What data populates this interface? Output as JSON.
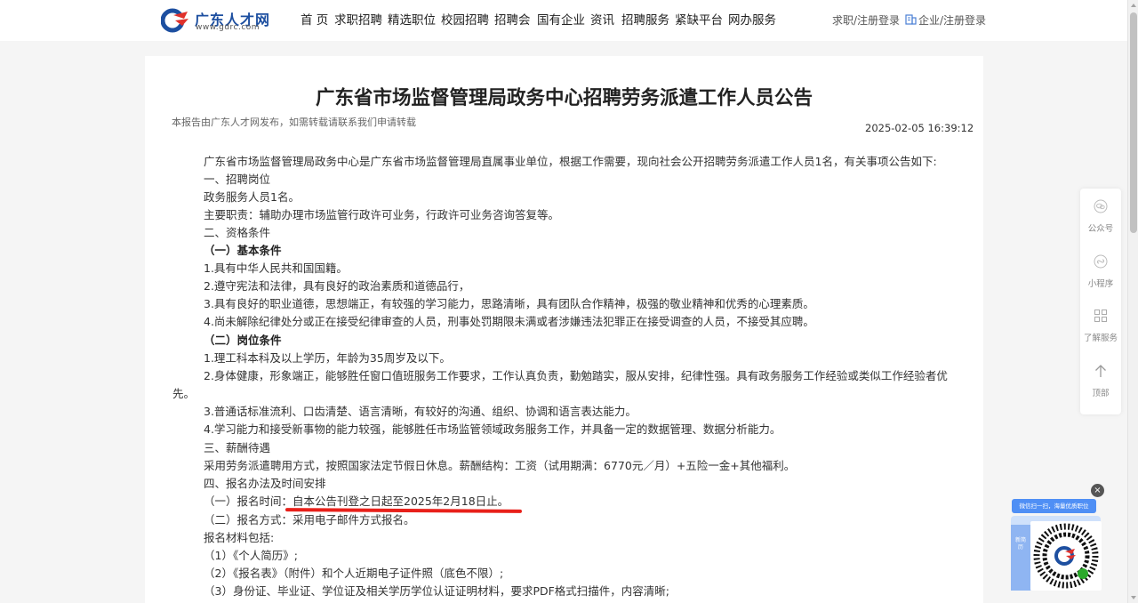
{
  "header": {
    "logo_title": "广东人才网",
    "logo_url": "www.gdrc.com",
    "nav": [
      "首 页",
      "求职招聘",
      "精选职位",
      "校园招聘",
      "招聘会",
      "国有企业",
      "资讯",
      "招聘服务",
      "紧缺平台",
      "网办服务"
    ],
    "login_personal": "求职/注册登录",
    "login_company": "企业/注册登录"
  },
  "article": {
    "title": "广东省市场监督管理局政务中心招聘劳务派遣工作人员公告",
    "source": "本报告由广东人才网发布，如需转载请联系我们申请转载",
    "date": "2025-02-05 16:39:12",
    "lines": [
      "广东省市场监督管理局政务中心是广东省市场监督管理局直属事业单位，根据工作需要，现向社会公开招聘劳务派遣工作人员1名，有关事项公告如下:",
      "一、招聘岗位",
      "政务服务人员1名。",
      "主要职责：辅助办理市场监管行政许可业务，行政许可业务咨询答复等。",
      "二、资格条件",
      "（一）基本条件",
      "1.具有中华人民共和国国籍。",
      "2.遵守宪法和法律，具有良好的政治素质和道德品行，",
      "3.具有良好的职业道德，思想端正，有较强的学习能力，思路清晰，具有团队合作精神，极强的敬业精神和优秀的心理素质。",
      "4.尚未解除纪律处分或正在接受纪律审查的人员，刑事处罚期限未满或者涉嫌违法犯罪正在接受调查的人员，不接受其应聘。",
      "（二）岗位条件",
      "1.理工科本科及以上学历，年龄为35周岁及以下。",
      "2.身体健康，形象端正，能够胜任窗口值班服务工作要求，工作认真负责，勤勉踏实，服从安排，纪律性强。具有政务服务工作经验或类似工作经验者优",
      "先。",
      "3.普通话标准流利、口齿清楚、语言清晰，有较好的沟通、组织、协调和语言表达能力。",
      "4.学习能力和接受新事物的能力较强，能够胜任市场监管领域政务服务工作，并具备一定的数据管理、数据分析能力。",
      "三、薪酬待遇",
      "采用劳务派遣聘用方式，按照国家法定节假日休息。薪酬结构：工资（试用期满：6770元／月）+五险一金+其他福利。",
      "四、报名办法及时间安排",
      "（一）报名时间：自本公告刊登之日起至2025年2月18日止。",
      "（二）报名方式：采用电子邮件方式报名。",
      "报名材料包括:",
      "（1）《个人简历》;",
      "（2）《报名表》（附件）和个人近期电子证件照（底色不限）;",
      "（3）身份证、毕业证、学位证及相关学历学位认证证明材料，要求PDF格式扫描件，内容清晰;"
    ]
  },
  "side_panel": {
    "items": [
      "公众号",
      "小程序",
      "了解服务",
      "顶部"
    ]
  },
  "qr_popup": {
    "banner": "微信扫一扫，海量优质职位",
    "side_text": "新简历",
    "close": "×"
  },
  "colors": {
    "brand_blue": "#1d4fa0",
    "logo_red": "#e0312b",
    "highlight_underline": "#e8201a",
    "qr_banner": "#4f8ff5"
  }
}
